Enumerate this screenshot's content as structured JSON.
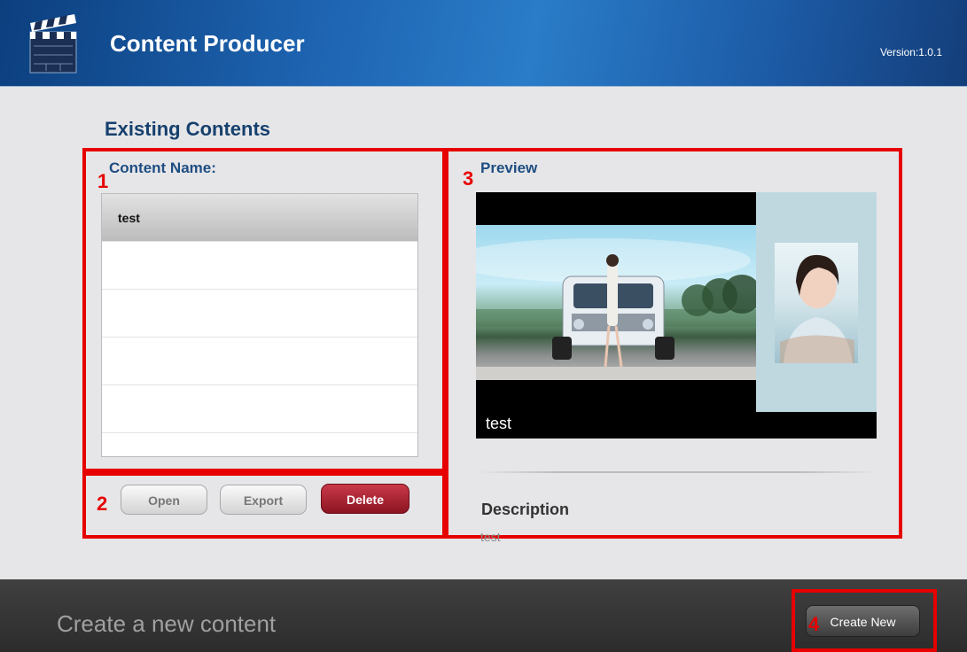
{
  "header": {
    "title": "Content Producer",
    "version": "Version:1.0.1"
  },
  "existing": {
    "title": "Existing Contents",
    "content_name_label": "Content Name:",
    "items": [
      "test",
      "",
      "",
      "",
      "",
      ""
    ]
  },
  "actions": {
    "open": "Open",
    "export": "Export",
    "delete": "Delete"
  },
  "preview": {
    "label": "Preview",
    "caption": "test"
  },
  "description": {
    "title": "Description",
    "text": "test"
  },
  "footer": {
    "text": "Create a new content",
    "create_label": "Create New"
  },
  "annotations": [
    "1",
    "2",
    "3",
    "4"
  ],
  "icons": {
    "logo": "clapperboard-icon"
  },
  "colors": {
    "annotation": "#e60000",
    "header_blue": "#1f66b4",
    "delete_red": "#a32030"
  }
}
